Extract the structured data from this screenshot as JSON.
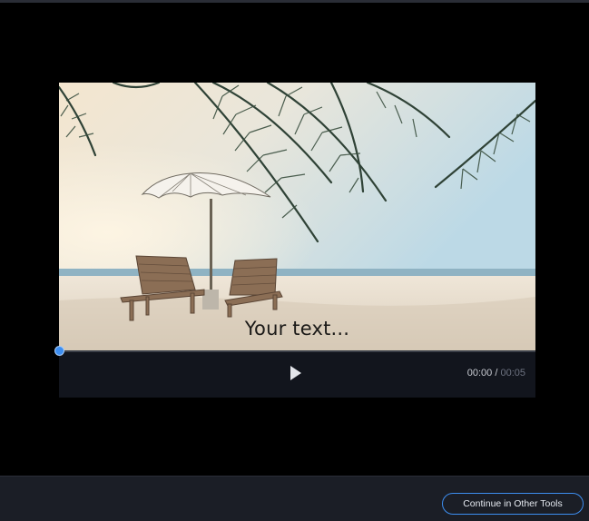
{
  "video": {
    "caption_text": "Your text...",
    "scene": "beach-with-umbrella-and-two-lounge-chairs"
  },
  "controls": {
    "current_time": "00:00",
    "separator": " / ",
    "total_time": "00:05",
    "progress": 0
  },
  "footer": {
    "continue_label": "Continue in Other Tools"
  },
  "colors": {
    "accent": "#3d8ef0",
    "controls_bg": "#12151d",
    "footer_bg": "#1b1e26",
    "page_bg": "#000000"
  }
}
